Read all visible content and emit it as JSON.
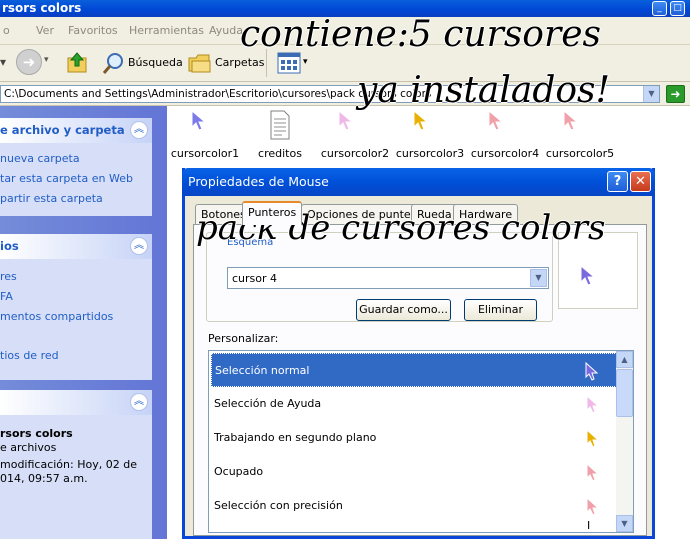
{
  "window": {
    "title": "rsors colors"
  },
  "menu": [
    "o",
    "Ver",
    "Favoritos",
    "Herramientas",
    "Ayuda"
  ],
  "toolbar": {
    "search": "Búsqueda",
    "folders": "Carpetas"
  },
  "address": "C:\\Documents and Settings\\Administrador\\Escritorio\\cursores\\pack cursors colors",
  "left": {
    "tasks": {
      "title": "e archivo y carpeta",
      "items": [
        "nueva carpeta",
        "tar esta carpeta en Web",
        "partir esta carpeta"
      ]
    },
    "places": {
      "title": "ios",
      "items": [
        "res",
        "FA",
        "mentos compartidos",
        "tios de red"
      ]
    },
    "details": {
      "title": "rsors colors",
      "lines": [
        "e archivos",
        "modificación: Hoy, 02 de",
        "014, 09:57 a.m."
      ]
    }
  },
  "files": [
    {
      "name": "cursorcolor1",
      "icon": "cursor-icon",
      "color": "#7a7ae8"
    },
    {
      "name": "creditos",
      "icon": "text-document-icon",
      "color": "#808080"
    },
    {
      "name": "cursorcolor2",
      "icon": "cursor-icon",
      "color": "#f0b8e8"
    },
    {
      "name": "cursorcolor3",
      "icon": "cursor-icon",
      "color": "#e8b000"
    },
    {
      "name": "cursorcolor4",
      "icon": "cursor-icon",
      "color": "#f0a0a8"
    },
    {
      "name": "cursorcolor5",
      "icon": "cursor-icon",
      "color": "#f0a0a8"
    }
  ],
  "dialog": {
    "title": "Propiedades de Mouse",
    "help": "?",
    "tabs": [
      "Botones",
      "Punteros",
      "Opciones de puntero",
      "Rueda",
      "Hardware"
    ],
    "scheme_label": "Esquema",
    "scheme_value": "cursor 4",
    "save_as": "Guardar como...",
    "delete": "Eliminar",
    "preview_color": "#7a6ae0",
    "personalize": "Personalizar:",
    "rows": [
      {
        "label": "Selección normal",
        "color": "#7a6ae0",
        "selected": true
      },
      {
        "label": "Selección de Ayuda",
        "color": "#f0b8e8",
        "selected": false
      },
      {
        "label": "Trabajando en segundo plano",
        "color": "#e8b000",
        "selected": false
      },
      {
        "label": "Ocupado",
        "color": "#f0a0a8",
        "selected": false
      },
      {
        "label": "Selección con precisión",
        "color": "#f0a0a8",
        "selected": false
      }
    ],
    "beam": "I"
  },
  "overlay": {
    "line1": "contiene:5 cursores",
    "line2": "ya instalados!",
    "line3": "pack de cursores colors"
  }
}
